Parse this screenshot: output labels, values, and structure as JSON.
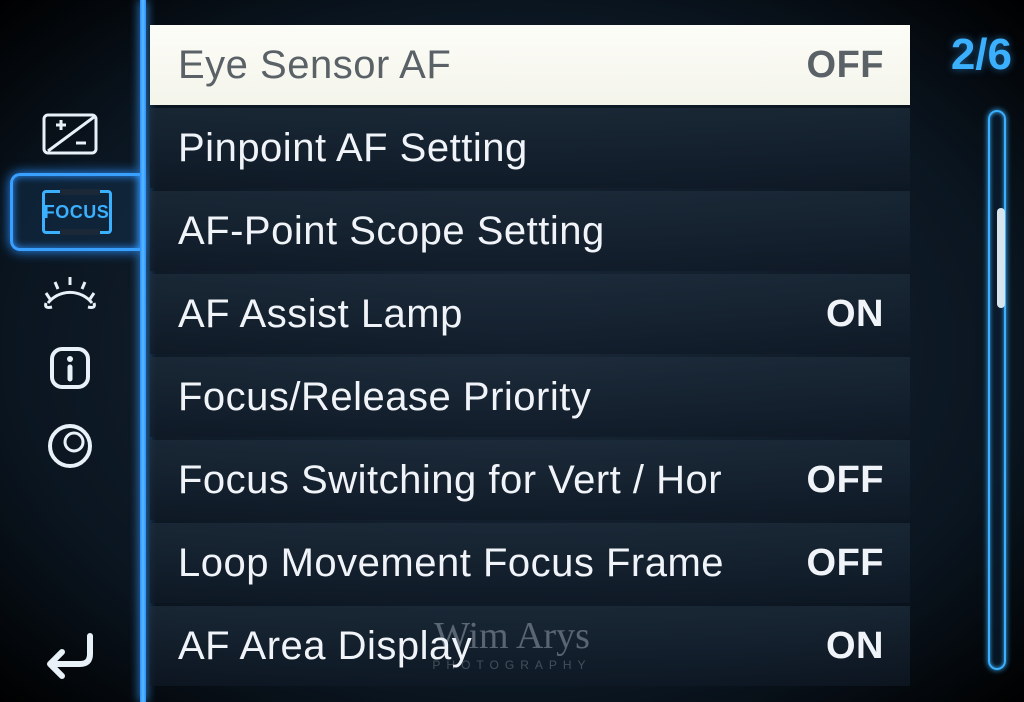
{
  "page": {
    "current": 2,
    "total": 6,
    "display": "2/6"
  },
  "sidebar": {
    "tabs": [
      {
        "name": "exposure-comp",
        "active": false
      },
      {
        "name": "focus",
        "active": true,
        "label": "FOCUS"
      },
      {
        "name": "gear",
        "active": false
      },
      {
        "name": "info",
        "active": false
      },
      {
        "name": "lens",
        "active": false
      }
    ],
    "back_label": "back"
  },
  "menu": {
    "items": [
      {
        "label": "Eye Sensor AF",
        "value": "OFF",
        "selected": true
      },
      {
        "label": "Pinpoint AF Setting",
        "value": "",
        "selected": false
      },
      {
        "label": "AF-Point Scope Setting",
        "value": "",
        "selected": false
      },
      {
        "label": "AF Assist Lamp",
        "value": "ON",
        "selected": false
      },
      {
        "label": "Focus/Release Priority",
        "value": "",
        "selected": false
      },
      {
        "label": "Focus Switching for Vert / Hor",
        "value": "OFF",
        "selected": false
      },
      {
        "label": "Loop Movement Focus Frame",
        "value": "OFF",
        "selected": false
      },
      {
        "label": "AF Area Display",
        "value": "ON",
        "selected": false
      }
    ]
  },
  "watermark": {
    "name": "Wim Arys",
    "sub": "PHOTOGRAPHY"
  }
}
